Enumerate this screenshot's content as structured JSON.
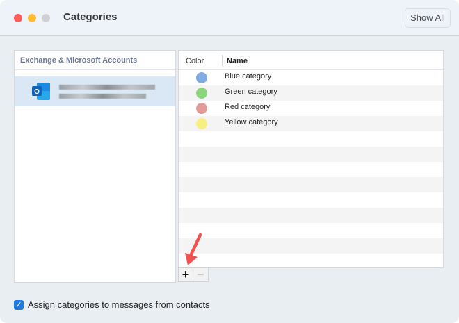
{
  "window": {
    "title": "Categories",
    "show_all": "Show All"
  },
  "accounts": {
    "header": "Exchange & Microsoft Accounts",
    "items": [
      {
        "icon": "outlook-icon",
        "redacted": true
      }
    ]
  },
  "table": {
    "columns": [
      "Color",
      "Name"
    ],
    "rows": [
      {
        "name": "Blue category",
        "color": "#7faae3"
      },
      {
        "name": "Green category",
        "color": "#8dd47f"
      },
      {
        "name": "Red category",
        "color": "#e49a9a"
      },
      {
        "name": "Yellow category",
        "color": "#f7ef82"
      }
    ]
  },
  "buttons": {
    "add": "+",
    "remove": "−"
  },
  "assign": {
    "label": "Assign categories to messages from contacts",
    "checked": true
  }
}
